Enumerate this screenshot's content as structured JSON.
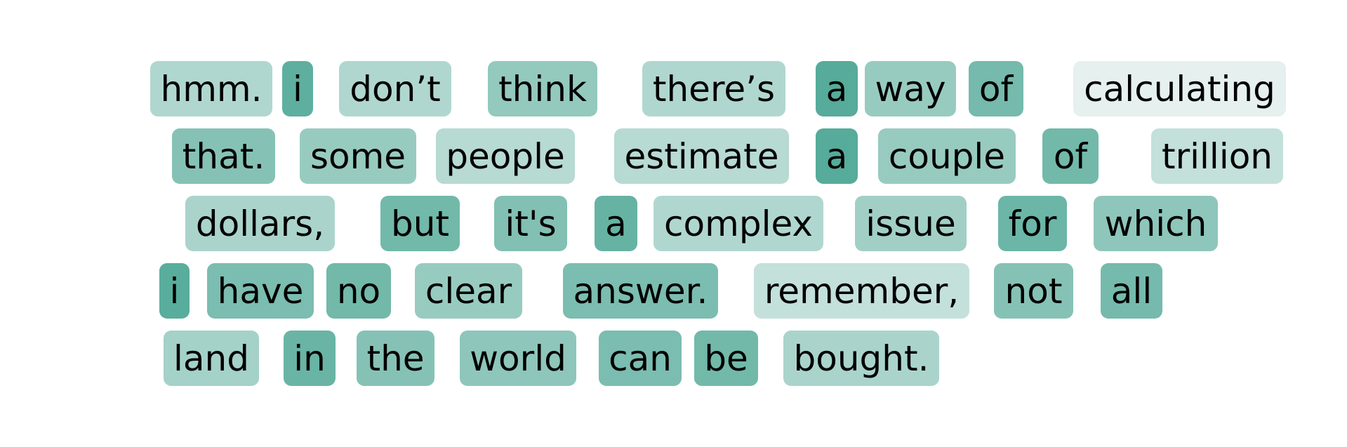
{
  "token_heatmap": {
    "color_low": "#f2f6f5",
    "color_high": "#56ab9a",
    "lines": [
      [
        {
          "text": "hmm.",
          "weight": 0.42
        },
        {
          "text": "i",
          "weight": 0.95
        },
        {
          "text": "don’t",
          "weight": 0.42
        },
        {
          "text": "think",
          "weight": 0.6
        },
        {
          "text": "there’s",
          "weight": 0.42
        },
        {
          "text": "a",
          "weight": 1.0
        },
        {
          "text": "way",
          "weight": 0.58
        },
        {
          "text": "of",
          "weight": 0.8
        },
        {
          "text": "calculating",
          "weight": 0.08
        }
      ],
      [
        {
          "text": "that.",
          "weight": 0.7
        },
        {
          "text": "some",
          "weight": 0.58
        },
        {
          "text": "people",
          "weight": 0.38
        },
        {
          "text": "estimate",
          "weight": 0.38
        },
        {
          "text": "a",
          "weight": 1.0
        },
        {
          "text": "couple",
          "weight": 0.58
        },
        {
          "text": "of",
          "weight": 0.82
        },
        {
          "text": "trillion",
          "weight": 0.3
        }
      ],
      [
        {
          "text": "dollars,",
          "weight": 0.46
        },
        {
          "text": "but",
          "weight": 0.82
        },
        {
          "text": "it's",
          "weight": 0.72
        },
        {
          "text": "a",
          "weight": 0.9
        },
        {
          "text": "complex",
          "weight": 0.42
        },
        {
          "text": "issue",
          "weight": 0.52
        },
        {
          "text": "for",
          "weight": 0.86
        },
        {
          "text": "which",
          "weight": 0.64
        }
      ],
      [
        {
          "text": "i",
          "weight": 0.98
        },
        {
          "text": "have",
          "weight": 0.76
        },
        {
          "text": "no",
          "weight": 0.82
        },
        {
          "text": "clear",
          "weight": 0.58
        },
        {
          "text": "answer.",
          "weight": 0.76
        },
        {
          "text": "remember,",
          "weight": 0.3
        },
        {
          "text": "not",
          "weight": 0.7
        },
        {
          "text": "all",
          "weight": 0.8
        }
      ],
      [
        {
          "text": "land",
          "weight": 0.5
        },
        {
          "text": "in",
          "weight": 0.88
        },
        {
          "text": "the",
          "weight": 0.7
        },
        {
          "text": "world",
          "weight": 0.64
        },
        {
          "text": "can",
          "weight": 0.76
        },
        {
          "text": "be",
          "weight": 0.82
        },
        {
          "text": "bought.",
          "weight": 0.46
        }
      ]
    ]
  }
}
